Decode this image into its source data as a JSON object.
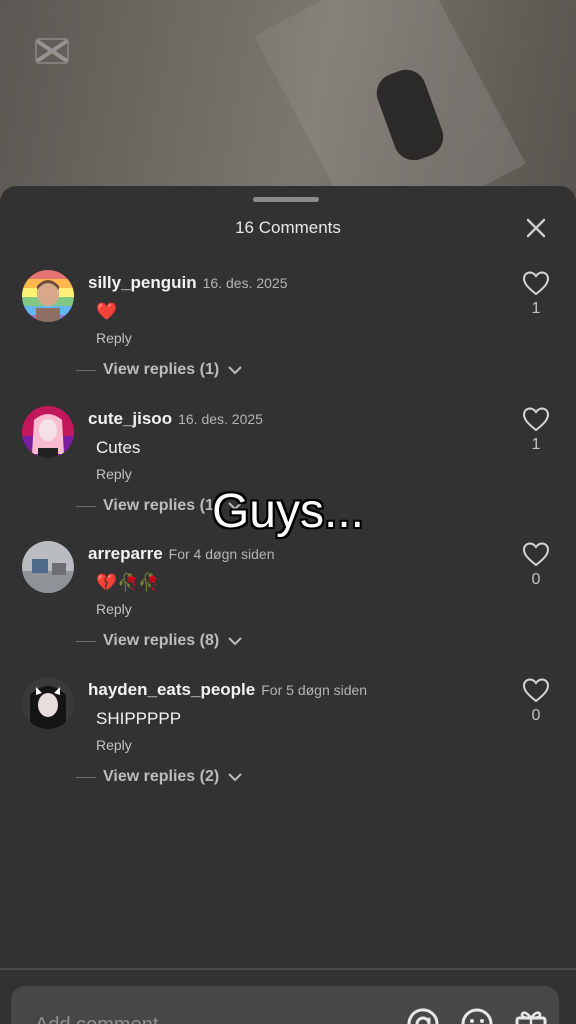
{
  "sheet": {
    "title": "16 Comments"
  },
  "overlay": {
    "caption": "Guys..."
  },
  "comments": [
    {
      "username": "silly_penguin",
      "time": "16. des. 2025",
      "text": "❤️",
      "reply": "Reply",
      "view_replies": "View replies (1)",
      "likes": "1"
    },
    {
      "username": "cute_jisoo",
      "time": "16. des. 2025",
      "text": "Cutes",
      "reply": "Reply",
      "view_replies": "View replies (1)",
      "likes": "1"
    },
    {
      "username": "arreparre",
      "time": "For 4 døgn siden",
      "text": "💔🥀🥀",
      "reply": "Reply",
      "view_replies": "View replies (8)",
      "likes": "0"
    },
    {
      "username": "hayden_eats_people",
      "time": "For 5 døgn siden",
      "text": "SHIPPPPP",
      "reply": "Reply",
      "view_replies": "View replies (2)",
      "likes": "0"
    }
  ],
  "input": {
    "placeholder": "Add comment..."
  },
  "icons": [
    "capcut-icon",
    "close-icon",
    "heart-icon",
    "chevron-down-icon",
    "mention-icon",
    "emoji-icon",
    "gift-icon"
  ],
  "colors": {
    "sheet": "#323232",
    "input": "#474747",
    "heart_red": "#e53935"
  }
}
